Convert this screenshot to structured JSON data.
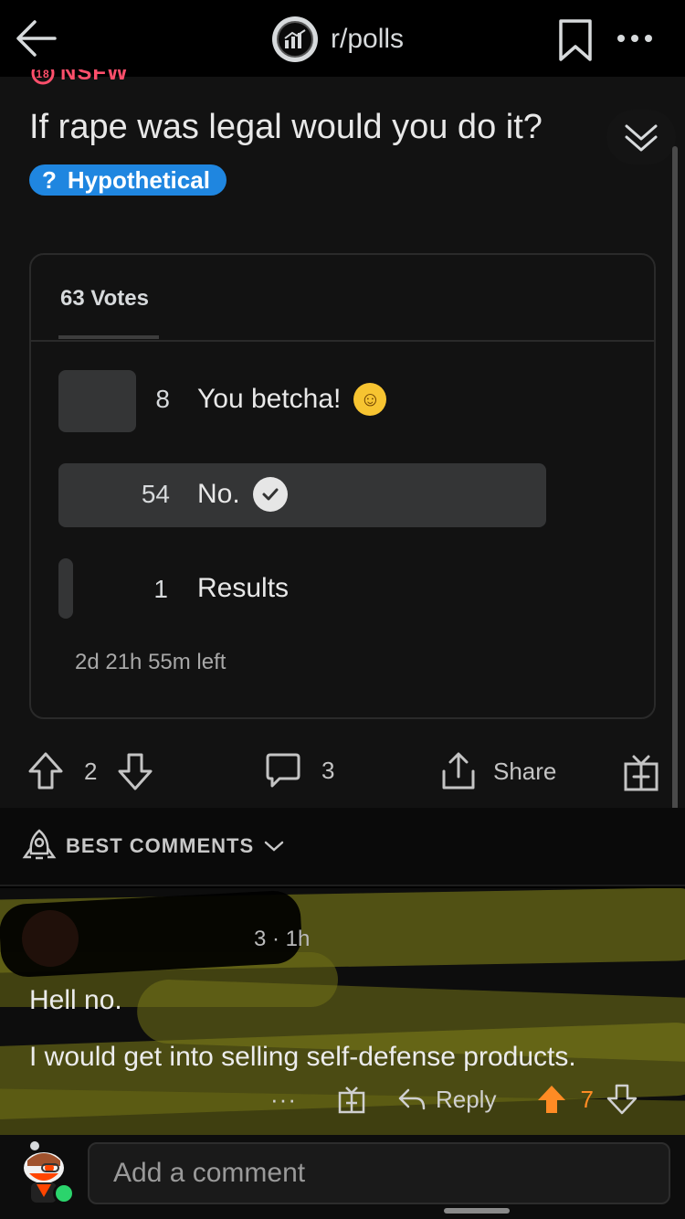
{
  "header": {
    "subreddit": "r/polls"
  },
  "post": {
    "nsfw_label": "NSFW",
    "title": "If rape was legal would you do it?",
    "flair_icon": "?",
    "flair_label": "Hypothetical",
    "flair_color": "#1f86e0"
  },
  "poll": {
    "votes_label": "63 Votes",
    "options": [
      {
        "count": "8",
        "label": "You betcha!",
        "fraction": 0.13
      },
      {
        "count": "54",
        "label": "No.",
        "fraction": 0.86,
        "selected": true
      },
      {
        "count": "1",
        "label": "Results",
        "fraction": 0.02
      }
    ],
    "time_left": "2d 21h 55m left"
  },
  "actions": {
    "score": "2",
    "comments": "3",
    "share_label": "Share"
  },
  "comments_sort": {
    "label": "BEST COMMENTS"
  },
  "comment": {
    "meta": "3 · 1h",
    "line1": "Hell no.",
    "line2": "I would get into selling self-defense products.",
    "more": "···",
    "reply_label": "Reply",
    "score": "7",
    "upvote_color": "#ff8b24"
  },
  "composer": {
    "placeholder": "Add a comment"
  }
}
